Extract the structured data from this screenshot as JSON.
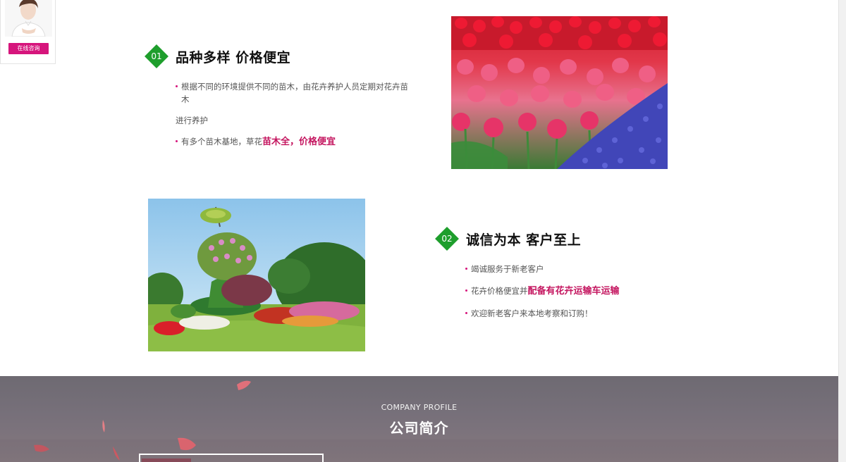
{
  "consult_widget": {
    "button_label": "在线咨询",
    "accent_color": "#d6157c"
  },
  "features": [
    {
      "number": "01",
      "title": "品种多样 价格便宜",
      "bullets": [
        {
          "text": "根据不同的环境提供不同的苗木，由花卉养护人员定期对花卉苗木",
          "continuation": "进行养护"
        },
        {
          "text": "有多个苗木基地，草花",
          "highlight": "苗木全，价格便宜"
        }
      ],
      "image_icon": "tulip-field-photo"
    },
    {
      "number": "02",
      "title": "诚信为本 客户至上",
      "bullets": [
        {
          "text": "竭诚服务于新老客户"
        },
        {
          "text": "花卉价格便宜并",
          "highlight": "配备有花卉运输车运输"
        },
        {
          "text": "欢迎新老客户来本地考察和订购！"
        }
      ],
      "image_icon": "topiary-garden-photo"
    }
  ],
  "company_profile": {
    "label_en": "COMPANY PROFILE",
    "title_cn": "公司简介"
  },
  "colors": {
    "diamond_green": "#1e9e2c",
    "highlight_pink": "#c4155f",
    "section_bg": "#77707a"
  }
}
